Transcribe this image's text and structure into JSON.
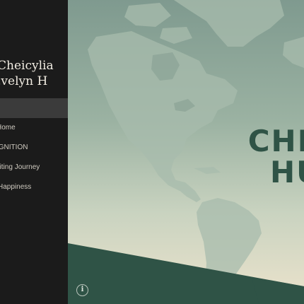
{
  "sidebar": {
    "site_title_line1": "Cheicylia",
    "site_title_line2": "Evelyn H",
    "nav_items": [
      {
        "label": ""
      },
      {
        "label": "Home"
      },
      {
        "label": "IGNITION"
      },
      {
        "label": "Writing Journey"
      },
      {
        "label": "Happiness"
      }
    ]
  },
  "hero": {
    "title_line1": "CHEICYLIA",
    "title_line2": "HUTAPEA"
  },
  "icons": {
    "info": "info-icon"
  },
  "colors": {
    "sidebar_bg": "#1b1b1b",
    "accent_green": "#2f5346",
    "sky_top": "#7f9a8f",
    "sky_bottom": "#ece3cc"
  }
}
